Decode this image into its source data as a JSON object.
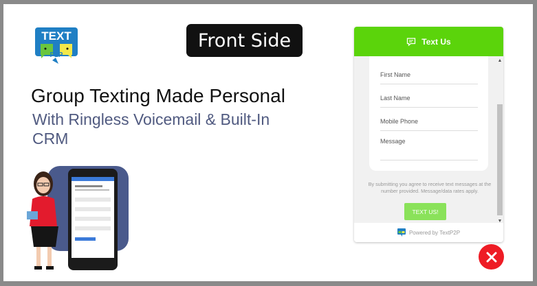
{
  "logo": {
    "line1": "TEXT",
    "mark": "P2P",
    "colors": {
      "blue": "#1f7fc4",
      "green": "#6ac63e",
      "yellow": "#f2e84a"
    }
  },
  "badge": {
    "label": "Front Side"
  },
  "headline": "Group Texting Made Personal",
  "subhead": "With Ringless Voicemail & Built-In CRM",
  "widget": {
    "header": {
      "title": "Text Us",
      "icon": "chat-icon",
      "color": "#5bd40b"
    },
    "fields": [
      {
        "label": "First Name"
      },
      {
        "label": "Last Name"
      },
      {
        "label": "Mobile Phone"
      },
      {
        "label": "Message"
      }
    ],
    "disclaimer": "By submitting you agree to receive text messages at the number provided. Message/data rates apply.",
    "submit_label": "TEXT US!",
    "footer": "Powered by TextP2P"
  },
  "close": {
    "icon": "close-icon",
    "color": "#ee1c25"
  }
}
